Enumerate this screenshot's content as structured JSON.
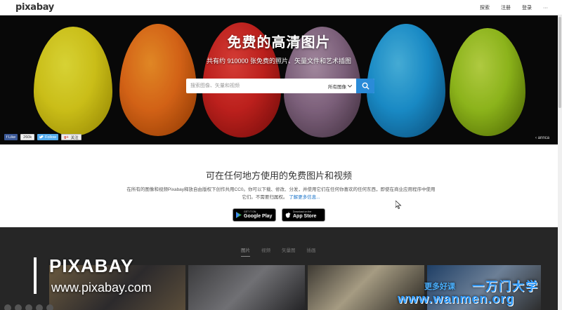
{
  "header": {
    "logo": "pixabay",
    "nav": [
      {
        "label": "探索"
      },
      {
        "label": "注册"
      },
      {
        "label": "登录"
      },
      {
        "label": "···"
      }
    ]
  },
  "hero": {
    "title": "免费的高清图片",
    "subtitle": "共有约 910000 张免费的照片、矢量文件和艺术插图",
    "search": {
      "placeholder": "搜索图像、矢量和视频",
      "filter": "所有图像"
    },
    "social": {
      "fb": "f Like",
      "fb_count": "260k",
      "twitter": "Follow",
      "gplus": "关注"
    },
    "credit": "annca"
  },
  "info": {
    "title": "可在任何地方使用的免费图片和视频",
    "text": "在所有的图像和视频Pixabay释放自由版权下创作共用CC0。你可以下载、修改、分发，并使用它们在任何你喜欢的任何东西，即使在商业应用程序中使用它们。不需要归属权。",
    "link": "了解更多信息...",
    "stores": [
      {
        "small": "GET IT ON",
        "big": "Google Play"
      },
      {
        "small": "Download on the",
        "big": "App Store"
      }
    ]
  },
  "gallery": {
    "tabs": [
      "图片",
      "视频",
      "矢量图",
      "插画"
    ]
  },
  "watermark": {
    "title": "PIXABAY",
    "url": "www.pixabay.com",
    "slogan": "更多好课",
    "brand": "一万门大学",
    "site": "www.wanmen.org"
  },
  "colors": {
    "accent": "#2a8bd8",
    "link": "#1a73c9"
  }
}
